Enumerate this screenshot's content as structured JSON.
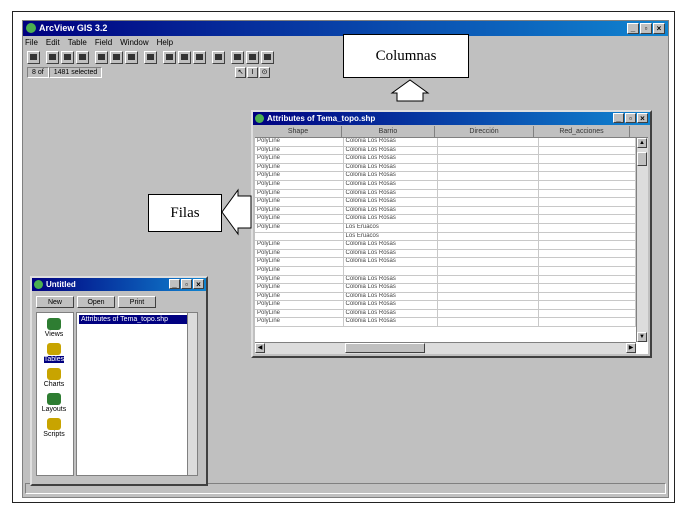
{
  "app": {
    "title": "ArcView GIS 3.2",
    "window_buttons": [
      "_",
      "▫",
      "×"
    ],
    "menus": [
      "File",
      "Edit",
      "Table",
      "Field",
      "Window",
      "Help"
    ],
    "status": {
      "count": "8 of",
      "selected": "1481 selected"
    },
    "toolbar2": [
      "↖",
      "I",
      "⊙"
    ]
  },
  "attributes_window": {
    "title": "Attributes of Tema_topo.shp",
    "columns": [
      "Shape",
      "Barrio",
      "Dirección",
      "Red_acciones"
    ],
    "rows": [
      [
        "PolyLine",
        "Colonia Los Rosas",
        "",
        ""
      ],
      [
        "PolyLine",
        "Colonia Los Rosas",
        "",
        ""
      ],
      [
        "PolyLine",
        "Colonia Los Rosas",
        "",
        ""
      ],
      [
        "PolyLine",
        "Colonia Los Rosas",
        "",
        ""
      ],
      [
        "PolyLine",
        "Colonia Los Rosas",
        "",
        ""
      ],
      [
        "PolyLine",
        "Colonia Los Rosas",
        "",
        ""
      ],
      [
        "PolyLine",
        "Colonia Los Rosas",
        "",
        ""
      ],
      [
        "PolyLine",
        "Colonia Los Rosas",
        "",
        ""
      ],
      [
        "PolyLine",
        "Colonia Los Rosas",
        "",
        ""
      ],
      [
        "PolyLine",
        "Colonia Los Rosas",
        "",
        ""
      ],
      [
        "PolyLine",
        "Los Eruacos",
        "",
        ""
      ],
      [
        "",
        "Los Eruacos",
        "",
        ""
      ],
      [
        "PolyLine",
        "Colonia Los Rosas",
        "",
        ""
      ],
      [
        "PolyLine",
        "Colonia Los Rosas",
        "",
        ""
      ],
      [
        "PolyLine",
        "Colonia Los Rosas",
        "",
        ""
      ],
      [
        "PolyLine",
        "",
        "",
        ""
      ],
      [
        "PolyLine",
        "Colonia Los Rosas",
        "",
        ""
      ],
      [
        "PolyLine",
        "Colonia Los Rosas",
        "",
        ""
      ],
      [
        "PolyLine",
        "Colonia Los Rosas",
        "",
        ""
      ],
      [
        "PolyLine",
        "Colonia Los Rosas",
        "",
        ""
      ],
      [
        "PolyLine",
        "Colonia Los Rosas",
        "",
        ""
      ],
      [
        "PolyLine",
        "Colonia Los Rosas",
        "",
        ""
      ]
    ]
  },
  "project_window": {
    "title": "Untitled",
    "buttons": [
      "New",
      "Open",
      "Print"
    ],
    "icons": [
      {
        "label": "Views",
        "icon": "views-icon",
        "color": "#2e7d32"
      },
      {
        "label": "Tables",
        "icon": "tables-icon",
        "color": "#c8a400"
      },
      {
        "label": "Charts",
        "icon": "charts-icon",
        "color": "#c8a400"
      },
      {
        "label": "Layouts",
        "icon": "layouts-icon",
        "color": "#2e7d32"
      },
      {
        "label": "Scripts",
        "icon": "scripts-icon",
        "color": "#c8a400"
      }
    ],
    "selected_icon": "Tables",
    "documents": [
      "Attributes of Tema_topo.shp"
    ]
  },
  "callouts": {
    "columnas": "Columnas",
    "filas": "Filas"
  },
  "colors": {
    "titlebar": "#000080",
    "face": "#c0c0c0",
    "selection": "#000080"
  }
}
